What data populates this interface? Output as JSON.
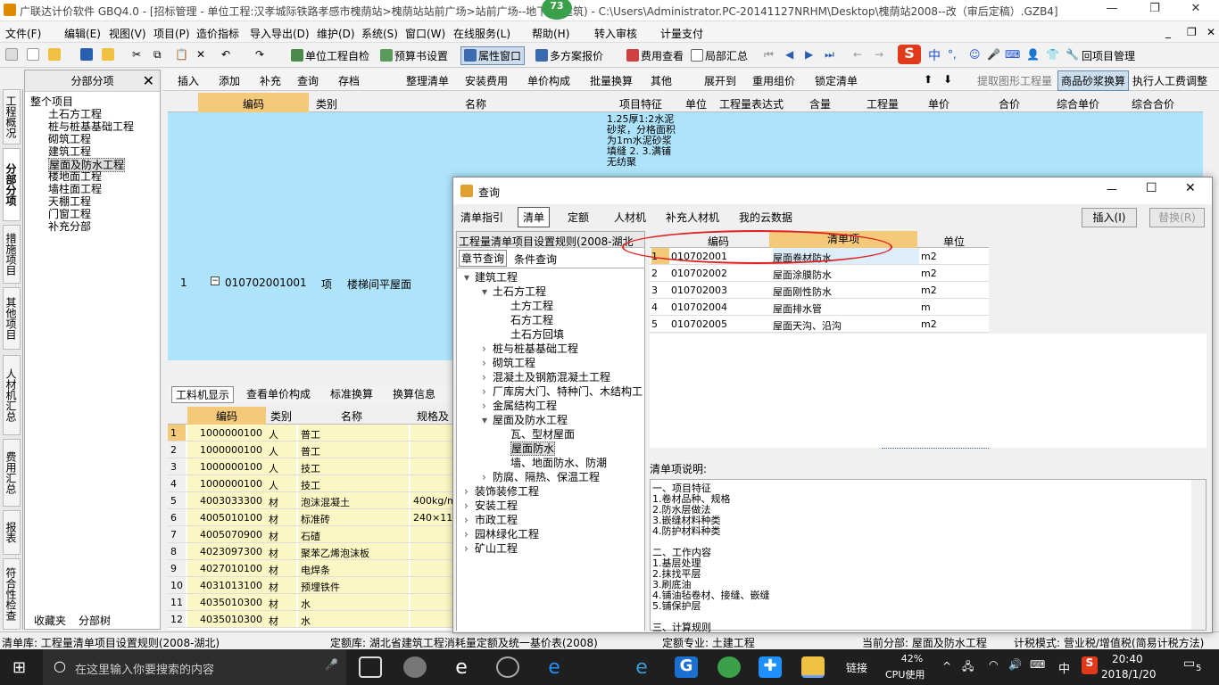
{
  "titlebar": {
    "title": "广联达计价软件 GBQ4.0 - [招标管理 - 单位工程:汉孝城际铁路孝感市槐荫站>槐荫站站前广场>站前广场--地下室(建筑) - C:\\Users\\Administrator.PC-20141127NRHM\\Desktop\\槐荫站2008--改（审后定稿）.GZB4]",
    "badge": "73"
  },
  "menu": [
    "文件(F)",
    "编辑(E)",
    "视图(V)",
    "项目(P)",
    "造价指标",
    "导入导出(D)",
    "维护(D)",
    "系统(S)",
    "窗口(W)",
    "在线服务(L)",
    "帮助(H)",
    "转入审核",
    "计量支付"
  ],
  "toolbar1": [
    "单位工程自检",
    "预算书设置",
    "属性窗口",
    "多方案报价",
    "费用查看",
    "局部汇总",
    "回项目管理"
  ],
  "ime": [
    "中",
    "°,"
  ],
  "sidetabs": [
    "工程概况",
    "分部分项",
    "措施项目",
    "其他项目",
    "人材机汇总",
    "费用汇总",
    "报表",
    "符合性检查"
  ],
  "tree": {
    "title": "分部分项",
    "nodes": [
      "整个项目",
      "土石方工程",
      "桩与桩基基础工程",
      "砌筑工程",
      "建筑工程",
      "屋面及防水工程",
      "楼地面工程",
      "墙柱面工程",
      "天棚工程",
      "门窗工程",
      "补充分部"
    ],
    "bottom_tabs": [
      "收藏夹",
      "分部树"
    ]
  },
  "toolbar2": [
    "插入",
    "添加",
    "补充",
    "查询",
    "存档",
    "整理清单",
    "安装费用",
    "单价构成",
    "批量换算",
    "其他",
    "展开到",
    "重用组价",
    "锁定清单",
    "提取图形工程量",
    "商品砂浆换算",
    "执行人工费调整"
  ],
  "grid1": {
    "headers": [
      "编码",
      "类别",
      "名称",
      "项目特征",
      "单位",
      "工程量表达式",
      "含量",
      "工程量",
      "单价",
      "合价",
      "综合单价",
      "综合合价"
    ],
    "row": {
      "no": "1",
      "code": "010702001001",
      "type": "项",
      "name": "楼梯间平屋面",
      "feature": "1.25厚1:2水泥砂浆，分格面积为1m水泥砂浆填缝 2. 3.满铺无纺聚"
    }
  },
  "bottom_tabs": [
    "工料机显示",
    "查看单价构成",
    "标准换算",
    "换算信息"
  ],
  "grid2": {
    "headers": [
      "编码",
      "类别",
      "名称",
      "规格及"
    ],
    "rows": [
      [
        "1",
        "1000000100",
        "人",
        "普工",
        ""
      ],
      [
        "2",
        "1000000100",
        "人",
        "普工",
        ""
      ],
      [
        "3",
        "1000000100",
        "人",
        "技工",
        ""
      ],
      [
        "4",
        "1000000100",
        "人",
        "技工",
        ""
      ],
      [
        "5",
        "4003033300",
        "材",
        "泡沫混凝土",
        "400kg/m3"
      ],
      [
        "6",
        "4005010100",
        "材",
        "标准砖",
        "240×115"
      ],
      [
        "7",
        "4005070900",
        "材",
        "石碴",
        ""
      ],
      [
        "8",
        "4023097300",
        "材",
        "聚苯乙烯泡沫板",
        ""
      ],
      [
        "9",
        "4027010100",
        "材",
        "电焊条",
        ""
      ],
      [
        "10",
        "4031013100",
        "材",
        "预埋铁件",
        ""
      ],
      [
        "11",
        "4035010300",
        "材",
        "水",
        ""
      ],
      [
        "12",
        "4035010300",
        "材",
        "水",
        ""
      ]
    ]
  },
  "dialog": {
    "title": "查询",
    "tabs": [
      "清单指引",
      "清单",
      "定额",
      "人材机",
      "补充人材机",
      "我的云数据"
    ],
    "insert": "插入(I)",
    "replace": "替换(R)",
    "rule": "工程量清单项目设置规则(2008-湖北",
    "subtabs": [
      "章节查询",
      "条件查询"
    ],
    "tree": [
      "建筑工程",
      "土石方工程",
      "土方工程",
      "石方工程",
      "土石方回填",
      "桩与桩基基础工程",
      "砌筑工程",
      "混凝土及钢筋混凝土工程",
      "厂库房大门、特种门、木结构工",
      "金属结构工程",
      "屋面及防水工程",
      "瓦、型材屋面",
      "屋面防水",
      "墙、地面防水、防潮",
      "防腐、隔热、保温工程",
      "装饰装修工程",
      "安装工程",
      "市政工程",
      "园林绿化工程",
      "矿山工程"
    ],
    "table_headers": [
      "编码",
      "清单项",
      "单位"
    ],
    "rows": [
      [
        "1",
        "010702001",
        "屋面卷材防水",
        "m2"
      ],
      [
        "2",
        "010702002",
        "屋面涂膜防水",
        "m2"
      ],
      [
        "3",
        "010702003",
        "屋面刚性防水",
        "m2"
      ],
      [
        "4",
        "010702004",
        "屋面排水管",
        "m"
      ],
      [
        "5",
        "010702005",
        "屋面天沟、沿沟",
        "m2"
      ]
    ],
    "desc_label": "清单项说明:",
    "desc": [
      "一、项目特征",
      "1.卷材品种、规格",
      "2.防水层做法",
      "3.嵌缝材料种类",
      "4.防护材料种类",
      "",
      "二、工作内容",
      "1.基层处理",
      "2.抹找平层",
      "3.刷底油",
      "4.铺油毡卷材、接缝、嵌缝",
      "5.铺保护层",
      "",
      "三、计算规则"
    ]
  },
  "status": [
    "清单库: 工程量清单项目设置规则(2008-湖北)",
    "定额库: 湖北省建筑工程消耗量定额及统一基价表(2008)",
    "定额专业: 土建工程",
    "当前分部: 屋面及防水工程",
    "计税模式: 营业税/增值税(简易计税方法)"
  ],
  "taskbar": {
    "search": "在这里输入你要搜索的内容",
    "link": "链接",
    "cpu": "42%",
    "cpu_label": "CPU使用",
    "lang": "中",
    "time": "20:40",
    "date": "2018/1/20",
    "notif": "5"
  }
}
